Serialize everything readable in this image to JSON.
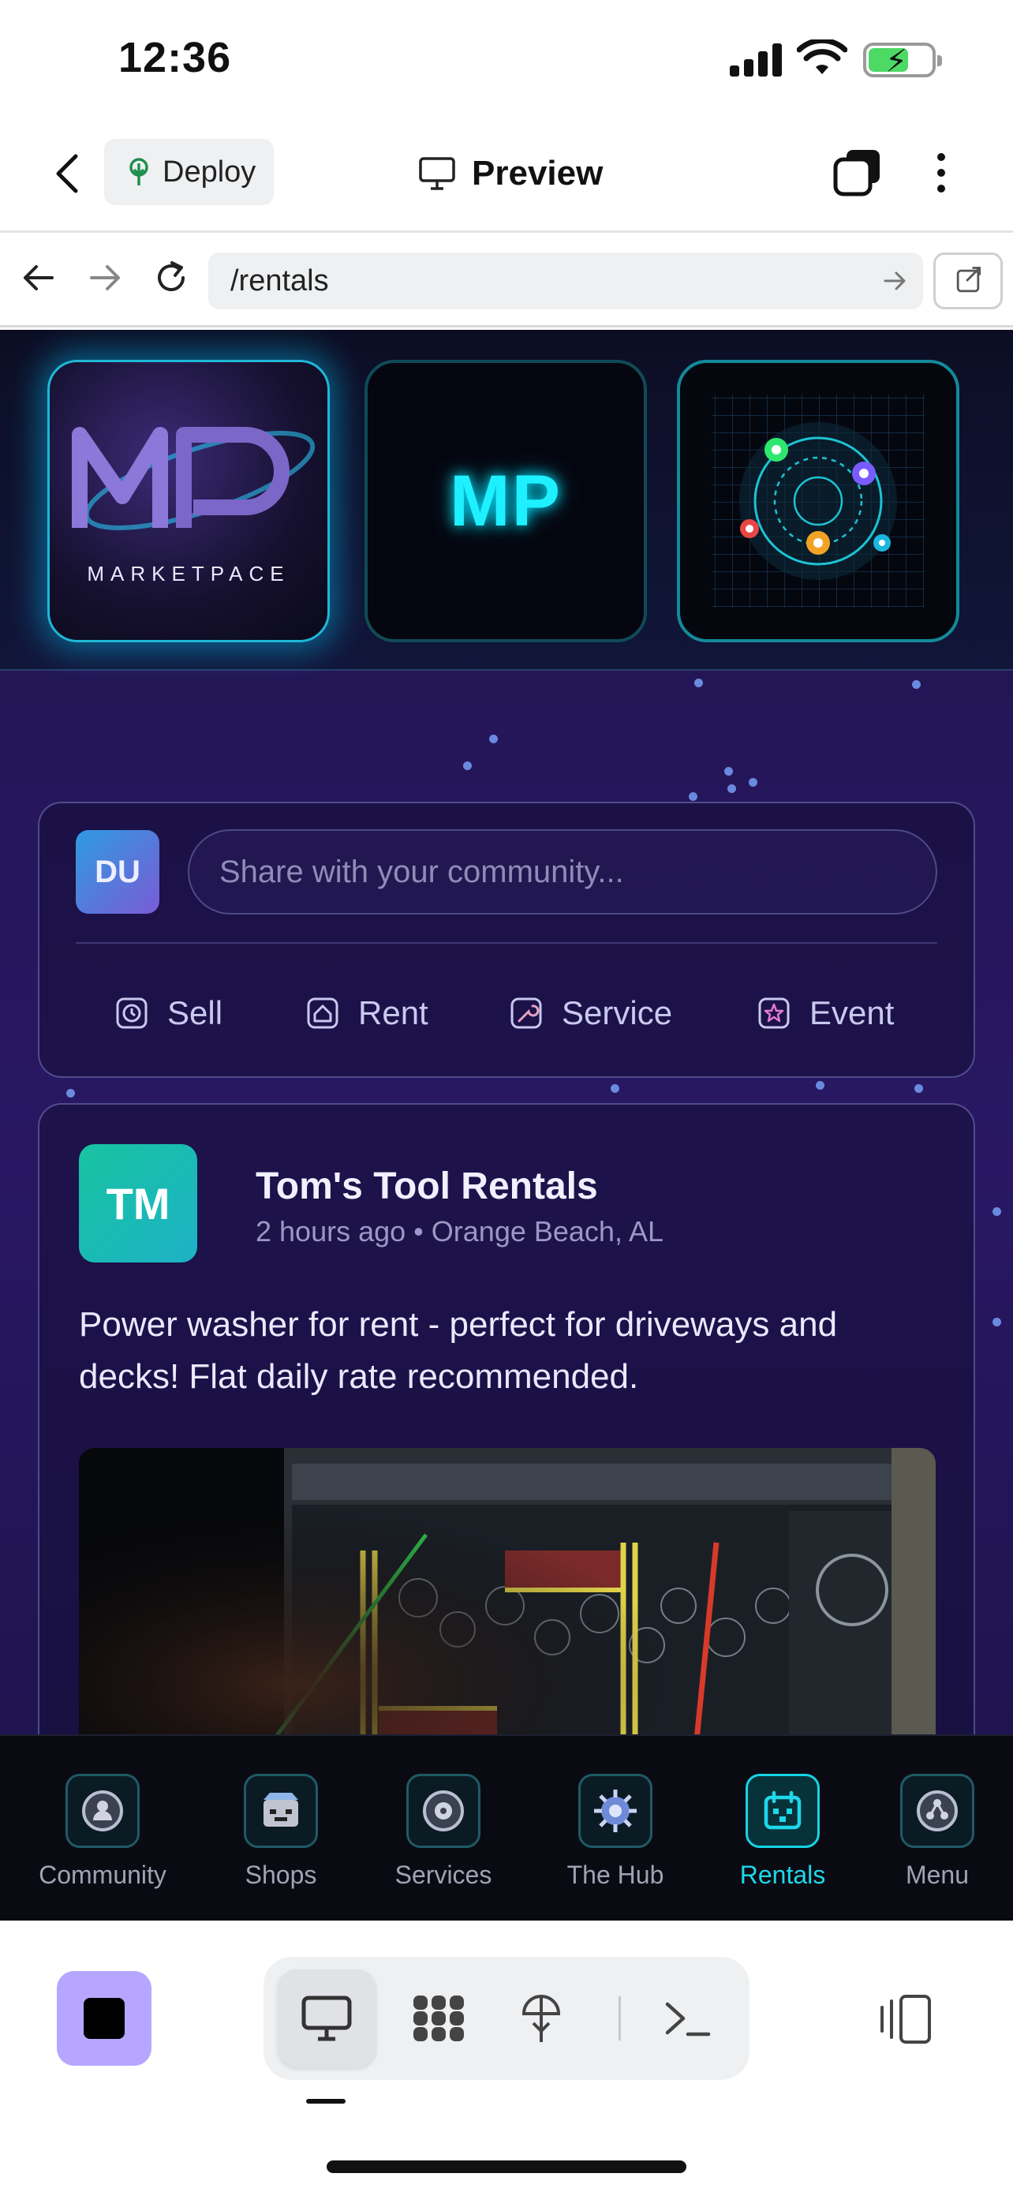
{
  "status_bar": {
    "time": "12:36"
  },
  "header": {
    "deploy_label": "Deploy",
    "preview_label": "Preview"
  },
  "url_bar": {
    "url": "/rentals"
  },
  "logo_strip": {
    "brand_name": "MARKETPACE",
    "tile2_text": "MP"
  },
  "composer": {
    "avatar_initials": "DU",
    "placeholder": "Share with your community...",
    "actions": [
      {
        "label": "Sell",
        "icon": "clock-icon"
      },
      {
        "label": "Rent",
        "icon": "house-icon"
      },
      {
        "label": "Service",
        "icon": "wrench-icon"
      },
      {
        "label": "Event",
        "icon": "star-icon"
      }
    ]
  },
  "post": {
    "avatar_initials": "TM",
    "author": "Tom's Tool Rentals",
    "time": "2 hours ago",
    "location": "Orange Beach, AL",
    "separator": "•",
    "text": "Power washer for rent - perfect for driveways and decks! Flat daily rate recommended."
  },
  "bottom_nav": {
    "items": [
      {
        "label": "Community",
        "icon": "community-icon"
      },
      {
        "label": "Shops",
        "icon": "shop-icon"
      },
      {
        "label": "Services",
        "icon": "services-icon"
      },
      {
        "label": "The Hub",
        "icon": "hub-icon"
      },
      {
        "label": "Rentals",
        "icon": "calendar-icon",
        "active": true
      },
      {
        "label": "Menu",
        "icon": "menu-icon"
      }
    ]
  },
  "colors": {
    "accent": "#1dd8ea",
    "background": "#25165a",
    "stop_button": "#b7a6ff"
  }
}
